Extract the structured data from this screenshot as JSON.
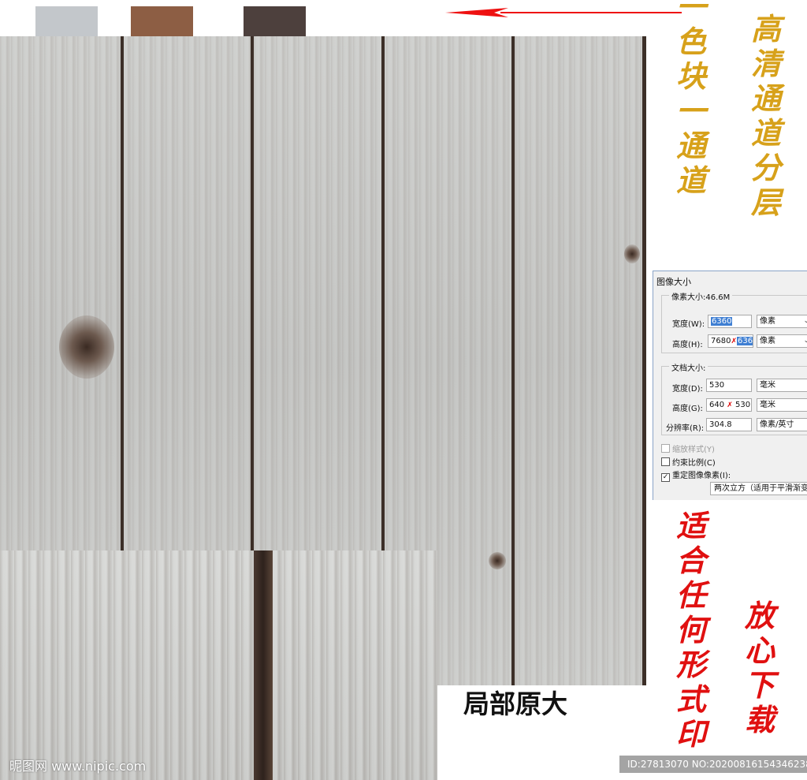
{
  "swatches": [
    {
      "color": "#c3c7cb"
    },
    {
      "color": "#8d5e44"
    },
    {
      "color": "#4d403d"
    }
  ],
  "annotations": {
    "one_swatch_one_channel": [
      "一",
      "色",
      "块",
      "一",
      "通",
      "道"
    ],
    "hd_channel_layers": [
      "高",
      "清",
      "通",
      "道",
      "分",
      "层"
    ],
    "fits_any_print": [
      "适",
      "合",
      "任",
      "何",
      "形",
      "式",
      "印"
    ],
    "download_assured": [
      "放",
      "心",
      "下",
      "载"
    ],
    "local_original": "局部原大"
  },
  "dialog": {
    "title": "图像大小",
    "pixel_size_label": "像素大小:46.6M",
    "width_label": "宽度(W):",
    "width_value": "6360",
    "width_unit": "像素",
    "height_label": "高度(H):",
    "height_value_old": "7680",
    "height_value_new": "6360",
    "height_unit": "像素",
    "doc_size_label": "文档大小:",
    "doc_width_label": "宽度(D):",
    "doc_width_value": "530",
    "doc_width_unit": "毫米",
    "doc_height_label": "高度(G):",
    "doc_height_value_old": "640",
    "doc_height_value_new": "530",
    "doc_height_unit": "毫米",
    "resolution_label": "分辨率(R):",
    "resolution_value": "304.8",
    "resolution_unit": "像素/英寸",
    "scale_styles": "缩放样式(Y)",
    "constrain": "约束比例(C)",
    "resample": "重定图像像素(I):",
    "resample_method": "两次立方（适用于平滑渐变"
  },
  "watermark": {
    "site": "昵图网 www.nipic.com",
    "id_line": "ID:27813070 NO:20200816154346238032"
  }
}
